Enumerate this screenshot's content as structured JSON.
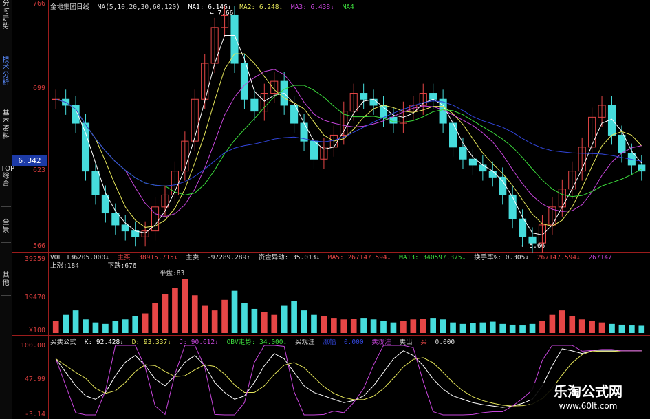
{
  "sidebar": {
    "tabs": [
      {
        "label": "分时走势",
        "active": false
      },
      {
        "label": "技术分析",
        "active": true
      },
      {
        "label": "基本资料",
        "active": false
      },
      {
        "label": "TOP综合",
        "active": false
      },
      {
        "label": "全景",
        "active": false
      },
      {
        "label": "其他",
        "active": false
      }
    ]
  },
  "price_axis": {
    "labels": [
      "766",
      "699",
      "623",
      "566"
    ],
    "current_badge": "6.342"
  },
  "header": {
    "title": "金地集团日线",
    "ma_params": "MA(5,10,20,30,60,120)",
    "ma1": "MA1: 6.146↓",
    "ma2": "MA2: 6.248↓",
    "ma3": "MA3: 6.438↓",
    "ma4": "MA4"
  },
  "annotations": {
    "high": "7.66",
    "low": "5.66"
  },
  "volume_panel": {
    "axis_labels": [
      "39259",
      "19470",
      "X100"
    ],
    "vol": "VOL 136205.000↓",
    "zhuli": "主买",
    "zhuli_val": "38915.715↓",
    "zhumai": "主卖",
    "zhumai_val": "-97289.289↑",
    "zijin": "资金异动: 35.013↓",
    "ma5": "MA5: 267147.594↓",
    "ma13": "MA13: 340597.375↓",
    "huanshou": "换手率%: 0.305↓",
    "ma5b": "267147.594↓",
    "ma5c": "267147",
    "shangzhang": "上涨:184",
    "xiadie": "下跌:676",
    "pingpan": "平盘:83"
  },
  "kdj_panel": {
    "axis_labels": [
      "100.00",
      "47.99",
      "-3.14"
    ],
    "name": "买卖公式",
    "k": "K: 92.428↓",
    "d": "D: 93.337↓",
    "j": "J: 90.612↓",
    "obv": "OBV走势: 34.000↓",
    "buy": "买观注",
    "up": "涨幅",
    "up_val": "0.000",
    "sell": "卖观注",
    "sell2": "卖出",
    "sell2_val": "买",
    "last": "0.000"
  },
  "watermark": {
    "title": "乐淘公式网",
    "url": "www.60lt.com"
  },
  "colors": {
    "up": "#e64646",
    "down": "#46dcdc",
    "ma1": "#ffffff",
    "ma2": "#e6e65a",
    "ma3": "#c846dc",
    "ma4": "#3cdc3c",
    "ma5": "#3246dc",
    "grid": "#9b1c1c"
  },
  "chart_data": {
    "type": "candlestick",
    "title": "金地集团日线",
    "ylim": [
      5.66,
      7.66
    ],
    "closes": [
      6.9,
      6.85,
      6.7,
      6.3,
      6.1,
      5.95,
      5.85,
      5.8,
      5.75,
      5.8,
      6.0,
      6.1,
      6.3,
      6.55,
      6.9,
      7.2,
      7.5,
      7.6,
      7.2,
      6.9,
      6.8,
      6.95,
      7.05,
      6.85,
      6.7,
      6.55,
      6.4,
      6.5,
      6.6,
      6.8,
      6.95,
      6.9,
      6.85,
      6.75,
      6.7,
      6.8,
      6.85,
      6.95,
      6.9,
      6.7,
      6.5,
      6.4,
      6.35,
      6.3,
      6.25,
      6.1,
      5.9,
      5.75,
      5.7,
      5.85,
      6.0,
      6.15,
      6.3,
      6.5,
      6.75,
      6.85,
      6.6,
      6.45,
      6.35,
      6.3
    ],
    "volume_range": [
      0,
      39259
    ],
    "kdj_range": [
      -3.14,
      100.0
    ],
    "volume": [
      8000,
      12000,
      15000,
      9000,
      7000,
      6000,
      8000,
      9000,
      11000,
      13000,
      20000,
      26000,
      30000,
      36000,
      25000,
      18000,
      15000,
      22000,
      28000,
      20000,
      16000,
      14000,
      12000,
      18000,
      21000,
      15000,
      12000,
      11000,
      10000,
      9000,
      9500,
      10000,
      9000,
      8000,
      7000,
      8000,
      9000,
      9500,
      10000,
      9000,
      7000,
      6000,
      6500,
      7000,
      7500,
      6000,
      5500,
      5000,
      6000,
      8000,
      12000,
      15000,
      11000,
      9000,
      8000,
      7000,
      6000,
      5500,
      5000,
      4800
    ],
    "k_values": [
      80,
      60,
      40,
      25,
      20,
      30,
      55,
      75,
      85,
      70,
      50,
      40,
      55,
      75,
      85,
      70,
      45,
      30,
      20,
      25,
      45,
      70,
      88,
      80,
      60,
      40,
      30,
      25,
      20,
      15,
      18,
      25,
      40,
      60,
      80,
      92,
      85,
      70,
      50,
      35,
      25,
      20,
      15,
      12,
      10,
      8,
      10,
      14,
      20,
      40,
      70,
      95,
      92,
      88,
      92,
      92,
      92,
      92,
      92,
      92
    ]
  }
}
